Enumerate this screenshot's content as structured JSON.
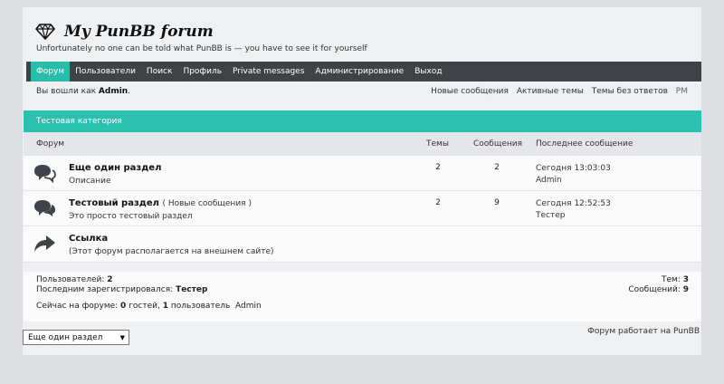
{
  "brand": {
    "title": "My PunBB forum",
    "tagline": "Unfortunately no one can be told what PunBB is — you have to see it for yourself"
  },
  "nav": [
    {
      "label": "Форум",
      "active": true
    },
    {
      "label": "Пользователи"
    },
    {
      "label": "Поиск"
    },
    {
      "label": "Профиль"
    },
    {
      "label": "Private messages"
    },
    {
      "label": "Администрирование"
    },
    {
      "label": "Выход"
    }
  ],
  "userbar": {
    "logged_prefix": "Вы вошли как",
    "username": "Admin",
    "suffix": ".",
    "links": [
      "Новые сообщения",
      "Активные темы",
      "Темы без ответов",
      "PM"
    ]
  },
  "category": {
    "title": "Тестовая категория"
  },
  "columns": {
    "forum": "Форум",
    "topics": "Темы",
    "posts": "Сообщения",
    "last": "Последнее сообщение"
  },
  "forums": [
    {
      "name": "Еще один раздел",
      "new_label": "",
      "desc": "Описание",
      "topics": "2",
      "posts": "2",
      "last_time": "Сегодня 13:03:03",
      "last_user": "Admin",
      "icon": "chat-bubbles-icon"
    },
    {
      "name": "Тестовый раздел",
      "new_label": "( Новые сообщения )",
      "desc": "Это просто тестовый раздел",
      "topics": "2",
      "posts": "9",
      "last_time": "Сегодня 12:52:53",
      "last_user": "Тестер",
      "icon": "chat-bubbles-new-icon"
    },
    {
      "name": "Ссылка",
      "new_label": "",
      "desc": "(Этот форум располагается на внешнем сайте)",
      "topics": "",
      "posts": "",
      "last_time": "",
      "last_user": "",
      "icon": "redirect-arrow-icon"
    }
  ],
  "stats": {
    "users_label": "Пользователей:",
    "users_count": "2",
    "last_reg_label": "Последним зарегистрировался:",
    "last_reg_user": "Тестер",
    "topics_label": "Тем:",
    "topics_count": "3",
    "posts_label": "Сообщений:",
    "posts_count": "9",
    "online_prefix": "Сейчас на форуме:",
    "guests_count": "0",
    "guests_label": "гостей,",
    "users_online_count": "1",
    "users_online_label": "пользователь",
    "online_user": "Admin"
  },
  "footer": {
    "jump_selected": "Еще один раздел",
    "powered": "Форум работает на PunBB"
  },
  "colors": {
    "accent": "#2cc0ae",
    "nav": "#3f4247"
  }
}
